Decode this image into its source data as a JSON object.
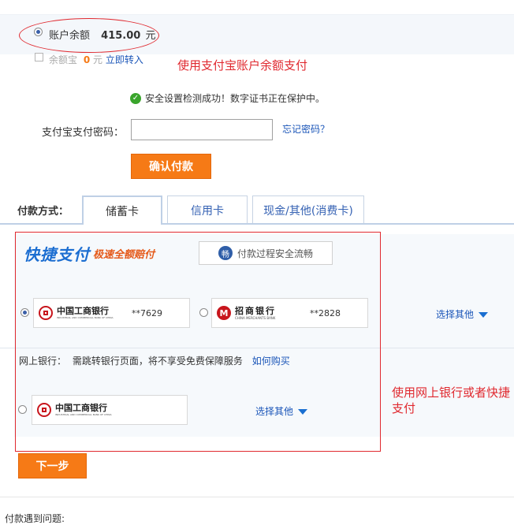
{
  "balance": {
    "label": "账户余额",
    "amount": "415.00",
    "unit": "元"
  },
  "yuebao": {
    "label": "余额宝",
    "amount": "0",
    "unit": "元",
    "link": "立即转入"
  },
  "annotations": {
    "balance_note": "使用支付宝账户余额支付",
    "bank_note": "使用网上银行或者快捷支付"
  },
  "security": {
    "message": "安全设置检测成功！数字证书正在保护中。"
  },
  "password": {
    "label": "支付宝支付密码：",
    "value": "",
    "forgot_link": "忘记密码？"
  },
  "confirm_button": "确认付款",
  "payment": {
    "label": "付款方式：",
    "tabs": [
      {
        "label": "储蓄卡",
        "active": true
      },
      {
        "label": "信用卡",
        "active": false
      },
      {
        "label": "现金/其他(消费卡)",
        "active": false
      }
    ]
  },
  "quickpay": {
    "logo_main": "快捷支付",
    "logo_sub": "极速全额赔付",
    "badge_icon": "畅",
    "badge_text": "付款过程安全流畅",
    "cards": [
      {
        "bank_name": "中国工商银行",
        "bank_en": "INDUSTRIAL AND COMMERCIAL BANK OF CHINA",
        "masked": "**7629",
        "selected": true
      },
      {
        "bank_name": "招商银行",
        "bank_en": "CHINA MERCHANTS BANK",
        "masked": "**2828",
        "selected": false
      }
    ],
    "choose_other": "选择其他"
  },
  "netbank": {
    "label": "网上银行：",
    "notice": "需跳转银行页面，将不享受免费保障服务",
    "link": "如何购买",
    "bank_name": "中国工商银行",
    "bank_en": "INDUSTRIAL AND COMMERCIAL BANK OF CHINA",
    "choose_other": "选择其他"
  },
  "next_button": "下一步",
  "problem_label": "付款遇到问题:",
  "colors": {
    "accent_orange": "#f67a16",
    "link_blue": "#1a55b8",
    "annotation_red": "#e0292f",
    "tab_border": "#bfd0e6"
  }
}
